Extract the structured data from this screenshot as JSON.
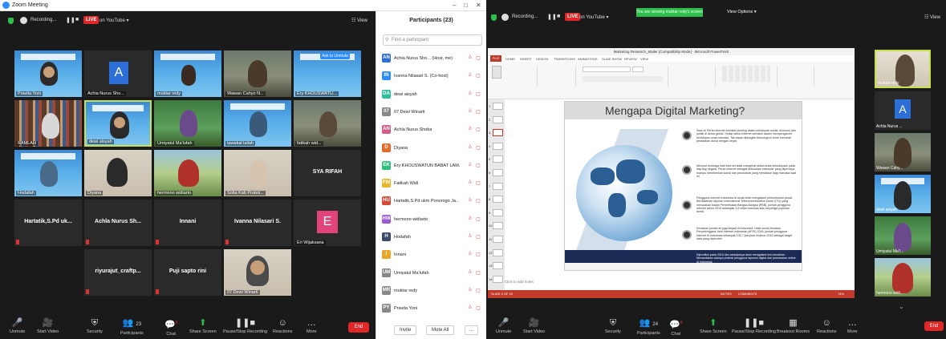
{
  "left": {
    "window_title": "Zoom Meeting",
    "recording": "Recording...",
    "live": "LIVE",
    "stream": "on YouTube ▾",
    "view": "☷ View",
    "tiles": [
      {
        "name": "Pravita Yoni"
      },
      {
        "name": "Achia Nurus Sho...",
        "avatar": "A"
      },
      {
        "name": "muktar redy"
      },
      {
        "name": "Wawan Cahyo N..."
      },
      {
        "name": "Ery KHOUSWATU..."
      },
      {
        "name": "RAMLAH"
      },
      {
        "name": "dewi aisyah"
      },
      {
        "name": "Umiyatul Ma'lufah"
      },
      {
        "name": "tawakal lailah"
      },
      {
        "name": "fatikah wid..."
      },
      {
        "name": "Hodafah"
      },
      {
        "name": "Diyana"
      },
      {
        "name": "hermono widiarto"
      },
      {
        "name": "Sofia Kab Probol..."
      },
      {
        "name": "SYA RIFAH"
      },
      {
        "name": "Hartatik,S.Pd uk..."
      },
      {
        "name": "Achla Nurus Sh..."
      },
      {
        "name": "Innani"
      },
      {
        "name": "Ivanna Nilasari S."
      },
      {
        "name": "Eri Wijaksana",
        "avatar": "E"
      },
      {
        "name": "riyurajut_craftp..."
      },
      {
        "name": "Puji sapto rini"
      },
      {
        "name": "07.Dewi Winarti"
      }
    ],
    "ask_unmute": "Ask to Unmute",
    "toolbar": {
      "unmute": "Unmute",
      "start_video": "Start Video",
      "security": "Security",
      "participants": "Participants",
      "participants_count": "23",
      "chat": "Chat",
      "chat_badge": "6",
      "share_screen": "Share Screen",
      "pause_stop": "Pause/Stop Recording",
      "reactions": "Reactions",
      "more": "More",
      "end": "End"
    }
  },
  "participants": {
    "title": "Participants (23)",
    "search_placeholder": "Find a participant",
    "list": [
      {
        "initials": "AN",
        "name": "Achia Nurus Sho... (Host, me)",
        "color": "#2d6fd8"
      },
      {
        "initials": "IN",
        "name": "Ivanna Nilasari S. (Co-host)",
        "color": "#2d8cff"
      },
      {
        "initials": "DA",
        "name": "dewi aisyah",
        "color": "#2cbf9a"
      },
      {
        "initials": "07",
        "name": "07.Dewi Winarti",
        "color": "#888888"
      },
      {
        "initials": "AN",
        "name": "Achla Nurus Shoba",
        "color": "#d65a8a"
      },
      {
        "initials": "D",
        "name": "Diyana",
        "color": "#e86a2a"
      },
      {
        "initials": "EK",
        "name": "Ery KHOUSWATUN BABAT LAM...",
        "color": "#2cbf7a"
      },
      {
        "initials": "FW",
        "name": "Fatikah Widi",
        "color": "#e8b62a"
      },
      {
        "initials": "HU",
        "name": "Hartatik,S.Pd ukm Ponorogo Ja...",
        "color": "#d64a3a"
      },
      {
        "initials": "HW",
        "name": "hermono widiarto",
        "color": "#9a5ad6"
      },
      {
        "initials": "H",
        "name": "Hodafah",
        "color": "#3a4a6a"
      },
      {
        "initials": "I",
        "name": "Innani",
        "color": "#e8a62a"
      },
      {
        "initials": "UM",
        "name": "Umiyatul Ma'lufah",
        "color": "#888888"
      },
      {
        "initials": "MR",
        "name": "muktar redy",
        "color": "#888888"
      },
      {
        "initials": "PY",
        "name": "Pravita Yoni",
        "color": "#888888"
      }
    ],
    "invite": "Invite",
    "mute_all": "Mute All",
    "more": "..."
  },
  "right": {
    "recording": "Recording...",
    "live": "LIVE",
    "stream": "on YouTube ▾",
    "banner": "You are viewing muktar redy's screen",
    "view_options": "View Options ▾",
    "view": "☷ View",
    "ppt_title": "Marketing Research_Mailer [Compatibility Mode] - Microsoft PowerPoint",
    "ppt_tabs": [
      "FILE",
      "HOME",
      "INSERT",
      "DESIGN",
      "TRANSITIONS",
      "ANIMATIONS",
      "SLIDE SHOW",
      "REVIEW",
      "VIEW"
    ],
    "slide_title": "Mengapa Digital Marketing?",
    "slide_texts": [
      "Saat ini Peran internet semakin penting dalam kehidupan sosial, ekonomi dan politik di dunia global. Setiap tahun internet semakin dalam mempengaruhi kehidupan umat manusia. Tak dapat dipungkiri teknologi ini telah merubah peradaban dunia dengan cepat.",
      "Menurut lembaga riset internet tidak mengenal sekat-sekat kebudayaan pada tiap-tiap negara. Peran internet sebagai kebutuhan sekunder yang dipercaya mampu memberikan solusi dan perubahan yang mendasar bagi manusia saat ini.",
      "Pengguna internet Indonesia di dunia telah mengalami pertumbuhan pesat. Berdasarkan laporan International Telecommunication Union (ITU) yang merupakan badan Perserikatan Bangsa-Bangsa (PBB), jumlah pengguna internet tahun 2016 sebanyak 3,5 miliar manusia atau sepertiga populasi dunia.",
      "Kenaikan jumlah ini juga terjadi di Indonesia. Hasil survei Asosiasi Penyelenggara Jasa Internet Indonesia (APJII) 2016, jumlah pengguna internet di Indonesia sebanyak 132,7 juta jiwa di tahun 2016 sebagai target data yang diperoleh.",
      "Diprediksi pada 2016 dan selanjutnya akan mengalami tren kenaikan. Menandakan adanya potensi pengguna layanan digital dan pemasaran online di Indonesia."
    ],
    "click_notes": "Click to add notes",
    "slide_numbers": [
      "1",
      "2",
      "3",
      "4",
      "5",
      "6",
      "7",
      "8",
      "9",
      "10",
      "11",
      "12",
      "13",
      "14"
    ],
    "slide_status": "SLIDE 3 OF 20",
    "notes_label": "NOTES",
    "comments_label": "COMMENTS",
    "zoom_pct": "74%",
    "tiles": [
      {
        "name": "muktar redy"
      },
      {
        "name": "Achla Nurus ...",
        "avatar": "A"
      },
      {
        "name": "Wawan Cahy..."
      },
      {
        "name": "dewi aisyah"
      },
      {
        "name": "Umiyatul Ma'l..."
      },
      {
        "name": "hermono widi..."
      }
    ],
    "toolbar": {
      "unmute": "Unmute",
      "start_video": "Start Video",
      "security": "Security",
      "participants": "Participants",
      "participants_count": "24",
      "chat": "Chat",
      "chat_badge": "9",
      "share_screen": "Share Screen",
      "pause_stop": "Pause/Stop Recording",
      "breakout": "Breakout Rooms",
      "reactions": "Reactions",
      "more": "More",
      "end": "End"
    }
  },
  "colors": {
    "zoom_blue": "#2d8cff",
    "live_red": "#e02828",
    "ppt_red": "#c0392b",
    "banner_green": "#2cbf4a",
    "active_border": "#c8e04c"
  }
}
